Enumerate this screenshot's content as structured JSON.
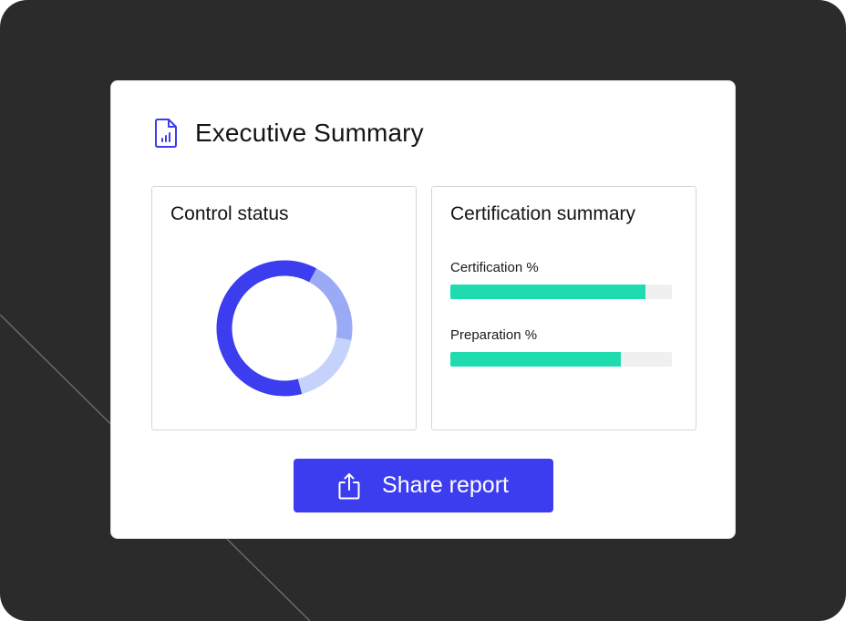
{
  "header": {
    "title": "Executive Summary",
    "icon": "document-chart-icon"
  },
  "control_status": {
    "title": "Control status",
    "chart_data": {
      "type": "pie",
      "values": [
        62,
        20,
        18
      ],
      "colors": [
        "#3d3df0",
        "#9aaaf5",
        "#c5d2fb"
      ]
    }
  },
  "certification_summary": {
    "title": "Certification summary",
    "metrics": [
      {
        "label": "Certification %",
        "value": 88
      },
      {
        "label": "Preparation %",
        "value": 77
      }
    ]
  },
  "share": {
    "label": "Share report",
    "icon": "share-icon"
  },
  "colors": {
    "background": "#2b2b2b",
    "accent": "#3d3df0",
    "progress": "#1edcb0"
  }
}
